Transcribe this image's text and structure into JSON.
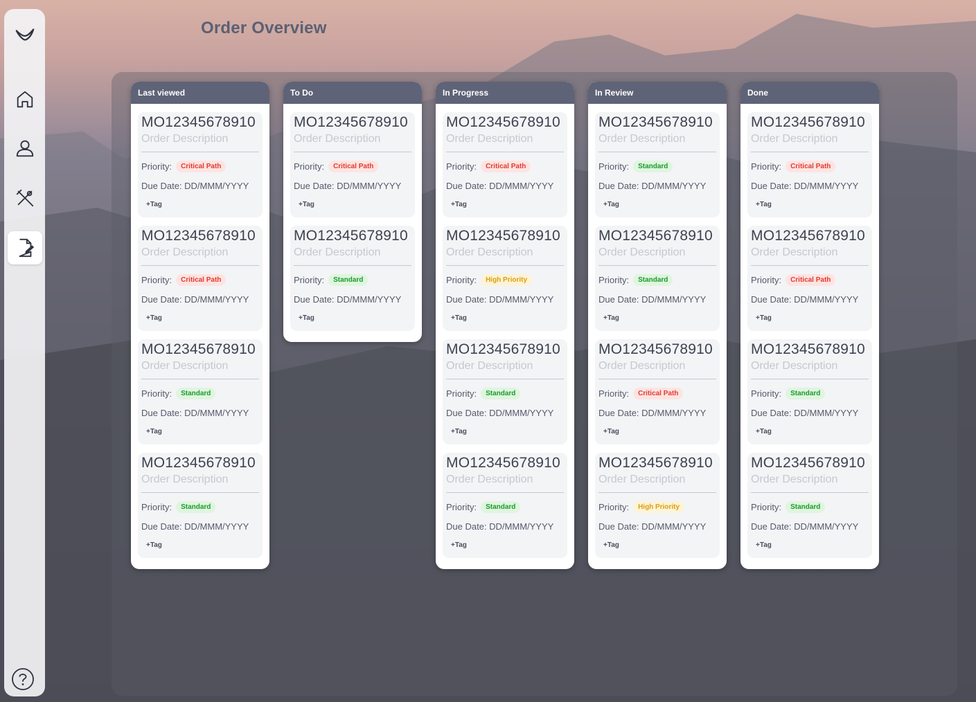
{
  "page": {
    "title": "Order Overview"
  },
  "sidebar": {
    "items": [
      {
        "name": "logo",
        "icon": "logo-icon"
      },
      {
        "name": "home",
        "icon": "home-icon"
      },
      {
        "name": "profile",
        "icon": "user-icon"
      },
      {
        "name": "tools",
        "icon": "tools-icon"
      },
      {
        "name": "orders",
        "icon": "edit-document-icon",
        "active": true
      }
    ],
    "help_icon": "help-icon"
  },
  "colors": {
    "column_header": "#5f6377",
    "critical": "#e23b2f",
    "standard": "#1c9a2c",
    "high": "#d9a10e"
  },
  "labels": {
    "priority": "Priority:",
    "due": "Due Date: DD/MMM/YYYY",
    "tag": "+Tag"
  },
  "columns": [
    {
      "title": "Last viewed",
      "cards": [
        {
          "id": "MO12345678910",
          "desc": "Order Description",
          "priority": "Critical Path",
          "level": "critical"
        },
        {
          "id": "MO12345678910",
          "desc": "Order Description",
          "priority": "Critical Path",
          "level": "critical"
        },
        {
          "id": "MO12345678910",
          "desc": "Order Description",
          "priority": "Standard",
          "level": "standard"
        },
        {
          "id": "MO12345678910",
          "desc": "Order Description",
          "priority": "Standard",
          "level": "standard"
        }
      ]
    },
    {
      "title": "To Do",
      "cards": [
        {
          "id": "MO12345678910",
          "desc": "Order Description",
          "priority": "Critical Path",
          "level": "critical"
        },
        {
          "id": "MO12345678910",
          "desc": "Order Description",
          "priority": "Standard",
          "level": "standard"
        }
      ]
    },
    {
      "title": "In Progress",
      "cards": [
        {
          "id": "MO12345678910",
          "desc": "Order Description",
          "priority": "Critical Path",
          "level": "critical"
        },
        {
          "id": "MO12345678910",
          "desc": "Order Description",
          "priority": "High Priority",
          "level": "high"
        },
        {
          "id": "MO12345678910",
          "desc": "Order Description",
          "priority": "Standard",
          "level": "standard"
        },
        {
          "id": "MO12345678910",
          "desc": "Order Description",
          "priority": "Standard",
          "level": "standard"
        }
      ]
    },
    {
      "title": "In Review",
      "cards": [
        {
          "id": "MO12345678910",
          "desc": "Order Description",
          "priority": "Standard",
          "level": "standard"
        },
        {
          "id": "MO12345678910",
          "desc": "Order Description",
          "priority": "Standard",
          "level": "standard"
        },
        {
          "id": "MO12345678910",
          "desc": "Order Description",
          "priority": "Critical Path",
          "level": "critical"
        },
        {
          "id": "MO12345678910",
          "desc": "Order Description",
          "priority": "High Priority",
          "level": "high"
        }
      ]
    },
    {
      "title": "Done",
      "cards": [
        {
          "id": "MO12345678910",
          "desc": "Order Description",
          "priority": "Critical Path",
          "level": "critical"
        },
        {
          "id": "MO12345678910",
          "desc": "Order Description",
          "priority": "Critical Path",
          "level": "critical"
        },
        {
          "id": "MO12345678910",
          "desc": "Order Description",
          "priority": "Standard",
          "level": "standard"
        },
        {
          "id": "MO12345678910",
          "desc": "Order Description",
          "priority": "Standard",
          "level": "standard"
        }
      ]
    }
  ]
}
